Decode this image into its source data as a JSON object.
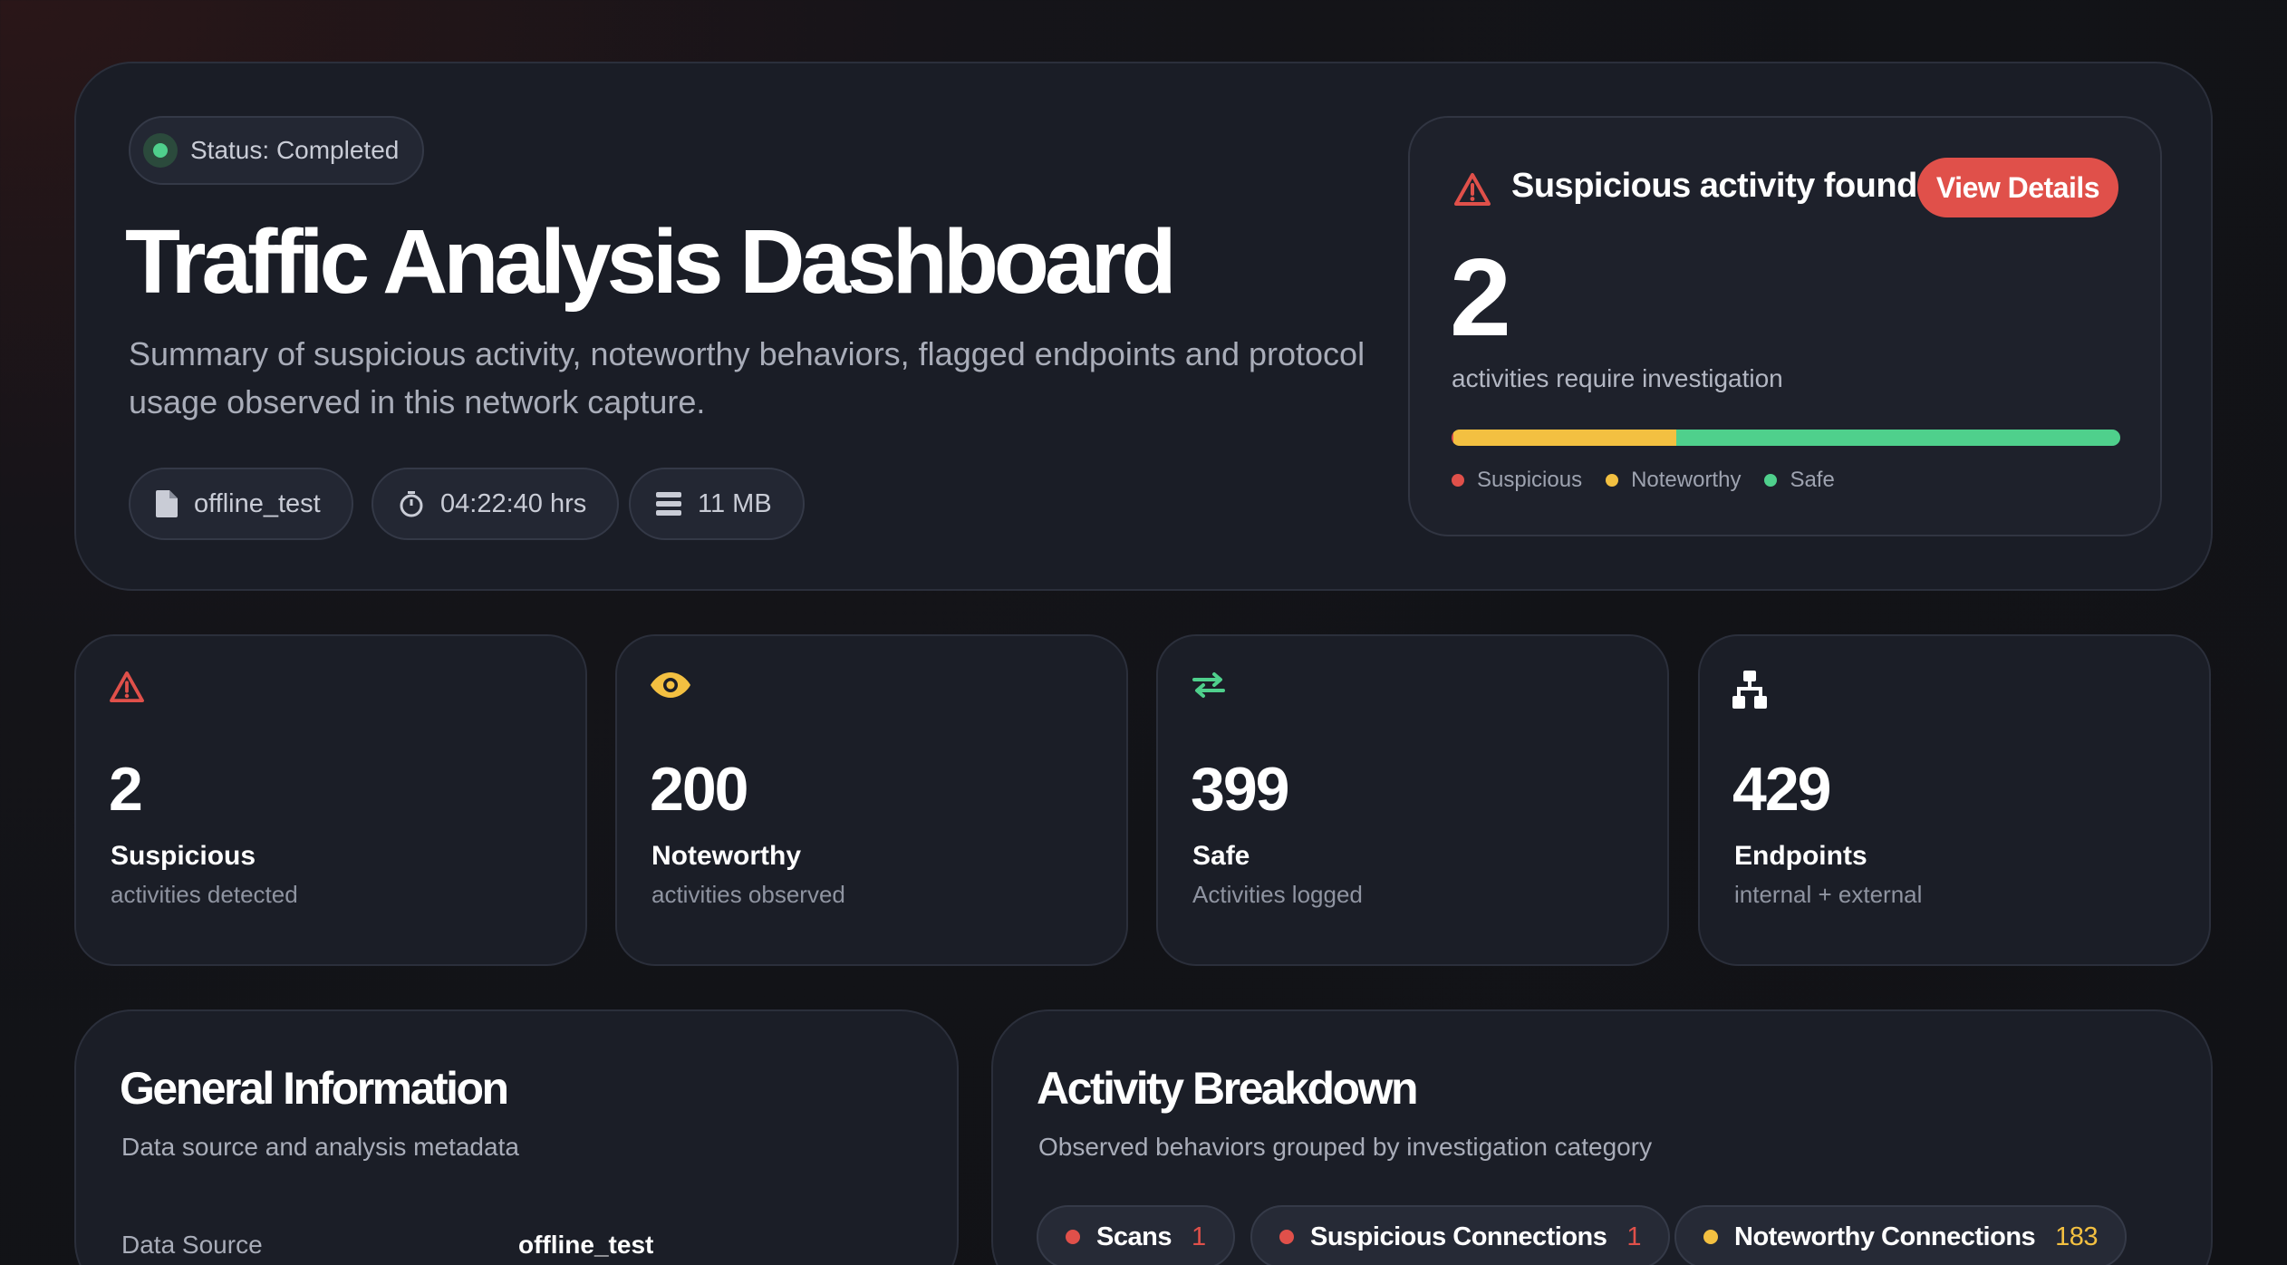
{
  "hero": {
    "status": "Status: Completed",
    "title": "Traffic Analysis Dashboard",
    "subtitle": "Summary of suspicious activity, noteworthy behaviors, flagged endpoints and protocol usage observed in this network capture.",
    "chips": {
      "file": "offline_test",
      "duration": "04:22:40 hrs",
      "size": "11 MB"
    }
  },
  "alert": {
    "title": "Suspicious activity found",
    "button": "View Details",
    "count": "2",
    "caption": "activities require investigation",
    "bar": {
      "suspicious": 2,
      "noteworthy": 200,
      "safe": 399
    },
    "legend": [
      "Suspicious",
      "Noteworthy",
      "Safe"
    ]
  },
  "stats": [
    {
      "value": "2",
      "label": "Suspicious",
      "sub": "activities detected",
      "icon": "warning-icon"
    },
    {
      "value": "200",
      "label": "Noteworthy",
      "sub": "activities observed",
      "icon": "eye-icon"
    },
    {
      "value": "399",
      "label": "Safe",
      "sub": "Activities logged",
      "icon": "arrows-exchange-icon"
    },
    {
      "value": "429",
      "label": "Endpoints",
      "sub": "internal + external",
      "icon": "network-icon"
    }
  ],
  "general": {
    "title": "General Information",
    "subtitle": "Data source and analysis metadata",
    "rows": [
      {
        "label": "Data Source",
        "value": "offline_test"
      }
    ]
  },
  "activity": {
    "title": "Activity Breakdown",
    "subtitle": "Observed behaviors grouped by investigation category",
    "categories": [
      {
        "label": "Scans",
        "count": "1"
      },
      {
        "label": "Suspicious Connections",
        "count": "1"
      },
      {
        "label": "Noteworthy Connections",
        "count": "183"
      }
    ]
  },
  "colors": {
    "suspicious": "#e0504a",
    "noteworthy": "#f3c041",
    "safe": "#4fd08c"
  }
}
